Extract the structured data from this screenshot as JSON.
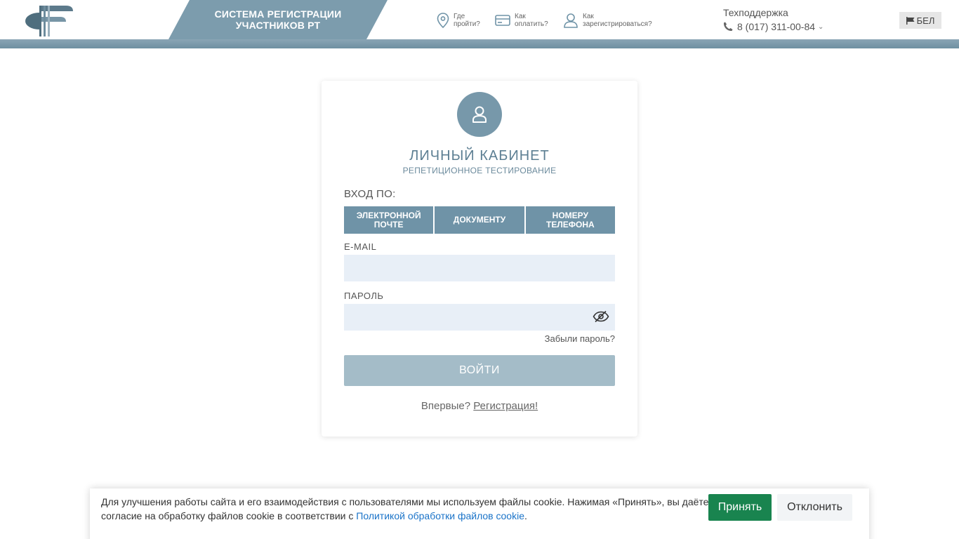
{
  "header": {
    "title_line1": "СИСТЕМА РЕГИСТРАЦИИ",
    "title_line2": "УЧАСТНИКОВ РТ",
    "nav": {
      "where": {
        "line1": "Где",
        "line2": "пройти?",
        "icon": "location-pin-icon"
      },
      "pay": {
        "line1": "Как",
        "line2": "оплатить?",
        "icon": "card-icon"
      },
      "register": {
        "line1": "Как",
        "line2": "зарегистрироваться?",
        "icon": "user-icon"
      }
    },
    "support": {
      "label": "Техподдержка",
      "phone": "8 (017) 311-00-84"
    },
    "language": "БЕЛ"
  },
  "login_card": {
    "title": "ЛИЧНЫЙ КАБИНЕТ",
    "subtitle": "РЕПЕТИЦИОННОЕ ТЕСТИРОВАНИЕ",
    "login_by": "ВХОД ПО:",
    "tabs": {
      "email": {
        "line1": "ЭЛЕКТРОННОЙ",
        "line2": "ПОЧТЕ"
      },
      "document": {
        "line1": "ДОКУМЕНТУ"
      },
      "phone": {
        "line1": "НОМЕРУ",
        "line2": "ТЕЛЕФОНА"
      }
    },
    "email_label": "E-MAIL",
    "email_value": "",
    "password_label": "ПАРОЛЬ",
    "password_value": "",
    "forgot": "Забыли пароль?",
    "submit": "ВОЙТИ",
    "first_time": "Впервые?",
    "register_link": "Регистрация!"
  },
  "cookie": {
    "text": "Для улучшения работы сайта и его взаимодействия с пользователями мы используем файлы cookie. Нажимая «Принять», вы даёте согласие на обработку файлов cookie в соответствии с ",
    "link": "Политикой обработки файлов cookie",
    "after": ".",
    "accept": "Принять",
    "decline": "Отклонить"
  },
  "colors": {
    "accent": "#7c9cad",
    "tab": "#6f93a7",
    "input_bg": "#e8eff7",
    "submit": "#a4bcc8",
    "accept": "#19844f",
    "link": "#1a73c8"
  }
}
